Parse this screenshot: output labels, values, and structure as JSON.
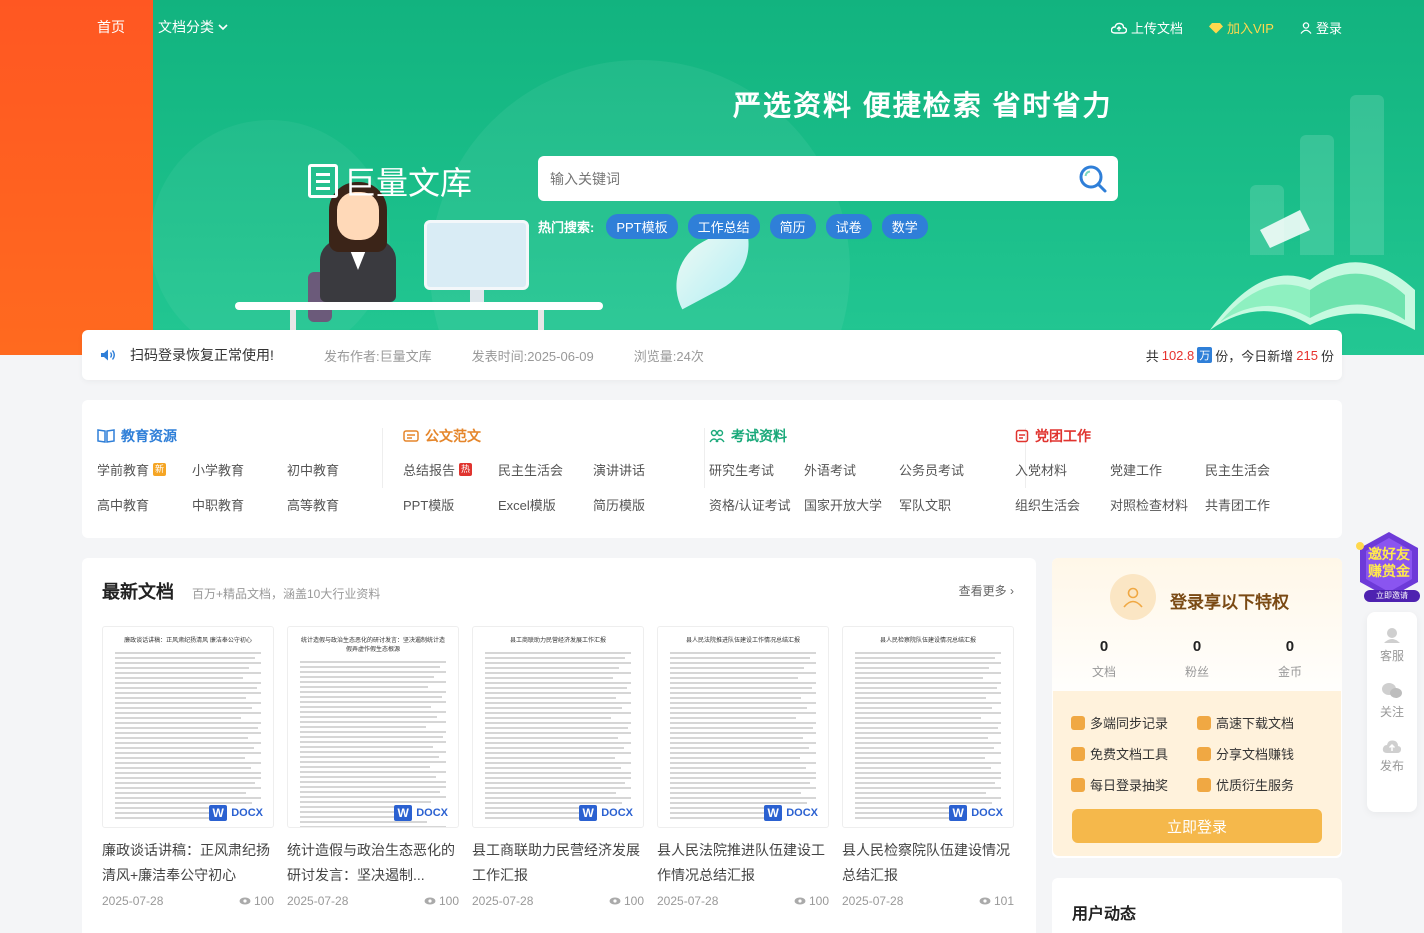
{
  "nav": {
    "home": "首页",
    "category": "文档分类",
    "upload": "上传文档",
    "vip": "加入VIP",
    "login": "登录"
  },
  "hero": {
    "slogan": "严选资料 便捷检索 省时省力",
    "logo_text": "巨量文库",
    "search_placeholder": "输入关键词",
    "hot_label": "热门搜索:",
    "hot_tags": [
      "PPT模板",
      "工作总结",
      "简历",
      "试卷",
      "数学"
    ]
  },
  "notice": {
    "title": "扫码登录恢复正常使用!",
    "author": "发布作者:巨量文库",
    "time": "发表时间:2025-06-09",
    "views": "浏览量:24次",
    "total_prefix": "共",
    "total": "102.8",
    "total_unit": "万",
    "total_suffix": "份，今日新增",
    "today": "215",
    "today_suffix": "份"
  },
  "categories": [
    {
      "title": "教育资源",
      "color": "#2f7fd8",
      "items": [
        "学前教育",
        "小学教育",
        "初中教育",
        "高中教育",
        "中职教育",
        "高等教育"
      ]
    },
    {
      "title": "公文范文",
      "color": "#e5862b",
      "items": [
        "总结报告",
        "民主生活会",
        "演讲讲话",
        "PPT模版",
        "Excel模版",
        "简历模版"
      ]
    },
    {
      "title": "考试资料",
      "color": "#1aa97a",
      "items": [
        "研究生考试",
        "外语考试",
        "公务员考试",
        "资格/认证考试",
        "国家开放大学",
        "军队文职"
      ]
    },
    {
      "title": "党团工作",
      "color": "#e0342f",
      "items": [
        "入党材料",
        "党建工作",
        "民主生活会",
        "组织生活会",
        "对照检查材料",
        "共青团工作"
      ]
    }
  ],
  "badges": {
    "new": "新",
    "hot": "热"
  },
  "latest": {
    "title": "最新文档",
    "subtitle": "百万+精品文档，涵盖10大行业资料",
    "more": "查看更多",
    "docx_label": "DOCX",
    "docx_w": "W",
    "docs": [
      {
        "thumb_title": "廉政谈话讲稿：正风肃纪扬清风 廉洁奉公守初心",
        "title": "廉政谈话讲稿：正风肃纪扬清风+廉洁奉公守初心",
        "date": "2025-07-28",
        "views": "100"
      },
      {
        "thumb_title": "统计造假与政治生态恶化的研讨发言：坚决遏制统计造假弄虚作假生态根源",
        "title": "统计造假与政治生态恶化的研讨发言：坚决遏制...",
        "date": "2025-07-28",
        "views": "100"
      },
      {
        "thumb_title": "县工商联助力民营经济发展工作汇报",
        "title": "县工商联助力民营经济发展工作汇报",
        "date": "2025-07-28",
        "views": "100"
      },
      {
        "thumb_title": "县人民法院推进队伍建设工作情况总结汇报",
        "title": "县人民法院推进队伍建设工作情况总结汇报",
        "date": "2025-07-28",
        "views": "100"
      },
      {
        "thumb_title": "县人民检察院队伍建设情况总结汇报",
        "title": "县人民检察院队伍建设情况总结汇报",
        "date": "2025-07-28",
        "views": "101"
      }
    ]
  },
  "login_panel": {
    "title": "登录享以下特权",
    "stats": [
      {
        "num": "0",
        "label": "文档"
      },
      {
        "num": "0",
        "label": "粉丝"
      },
      {
        "num": "0",
        "label": "金币"
      }
    ],
    "perks": [
      "多端同步记录",
      "高速下载文档",
      "免费文档工具",
      "分享文档赚钱",
      "每日登录抽奖",
      "优质衍生服务"
    ],
    "button": "立即登录"
  },
  "activity": {
    "title": "用户动态"
  },
  "invite": {
    "line1": "邀好友",
    "line2": "赚赏金",
    "cta": "立即邀请"
  },
  "side_tools": [
    "客服",
    "关注",
    "发布"
  ]
}
